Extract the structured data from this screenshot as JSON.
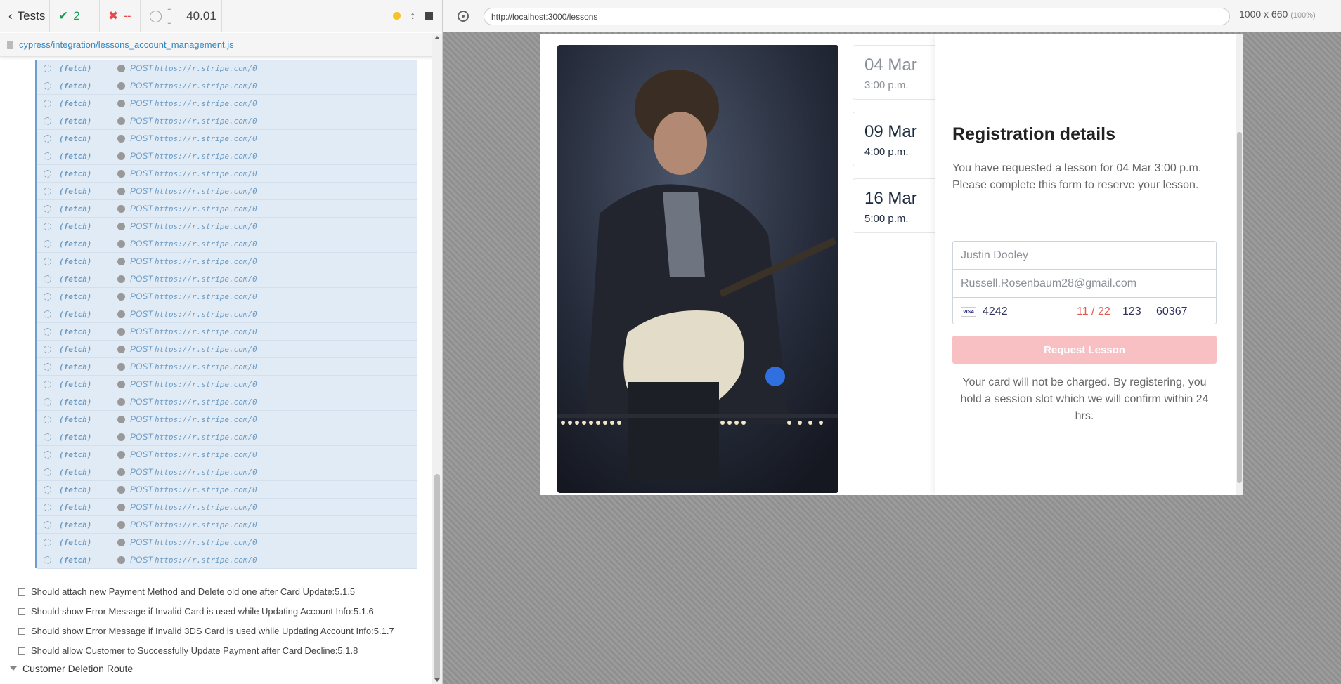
{
  "reporter": {
    "back_label": "Tests",
    "passed": "2",
    "failed": "--",
    "pending": "--",
    "duration": "40.01",
    "spec_path": "cypress/integration/lessons_account_management.js",
    "log_entry": {
      "type": "(fetch)",
      "method": "POST",
      "url": "https://r.stripe.com/0"
    },
    "log_count": 29,
    "tests": [
      "Should attach new Payment Method and Delete old one after Card Update:5.1.5",
      "Should show Error Message if Invalid Card is used while Updating Account Info:5.1.6",
      "Should show Error Message if Invalid 3DS Card is used while Updating Account Info:5.1.7",
      "Should allow Customer to Successfully Update Payment after Card Decline:5.1.8"
    ],
    "suite": "Customer Deletion Route"
  },
  "runner": {
    "url": "http://localhost:3000/lessons",
    "viewport": "1000 x 660",
    "zoom": "(100%)"
  },
  "app": {
    "dates": [
      {
        "day": "04 Mar",
        "time": "3:00 p.m."
      },
      {
        "day": "09 Mar",
        "time": "4:00 p.m."
      },
      {
        "day": "16 Mar",
        "time": "5:00 p.m."
      }
    ],
    "panel": {
      "title": "Registration details",
      "text_line1": "You have requested a lesson for 04 Mar 3:00 p.m.",
      "text_line2": "Please complete this form to reserve your lesson.",
      "name": "Justin Dooley",
      "email": "Russell.Rosenbaum28@gmail.com",
      "card_brand": "VISA",
      "card_number": "4242",
      "card_expiry": "11 / 22",
      "card_cvc": "123",
      "card_zip": "60367",
      "button": "Request Lesson",
      "note": "Your card will not be charged. By registering, you hold a session slot which we will confirm within 24 hrs."
    }
  }
}
